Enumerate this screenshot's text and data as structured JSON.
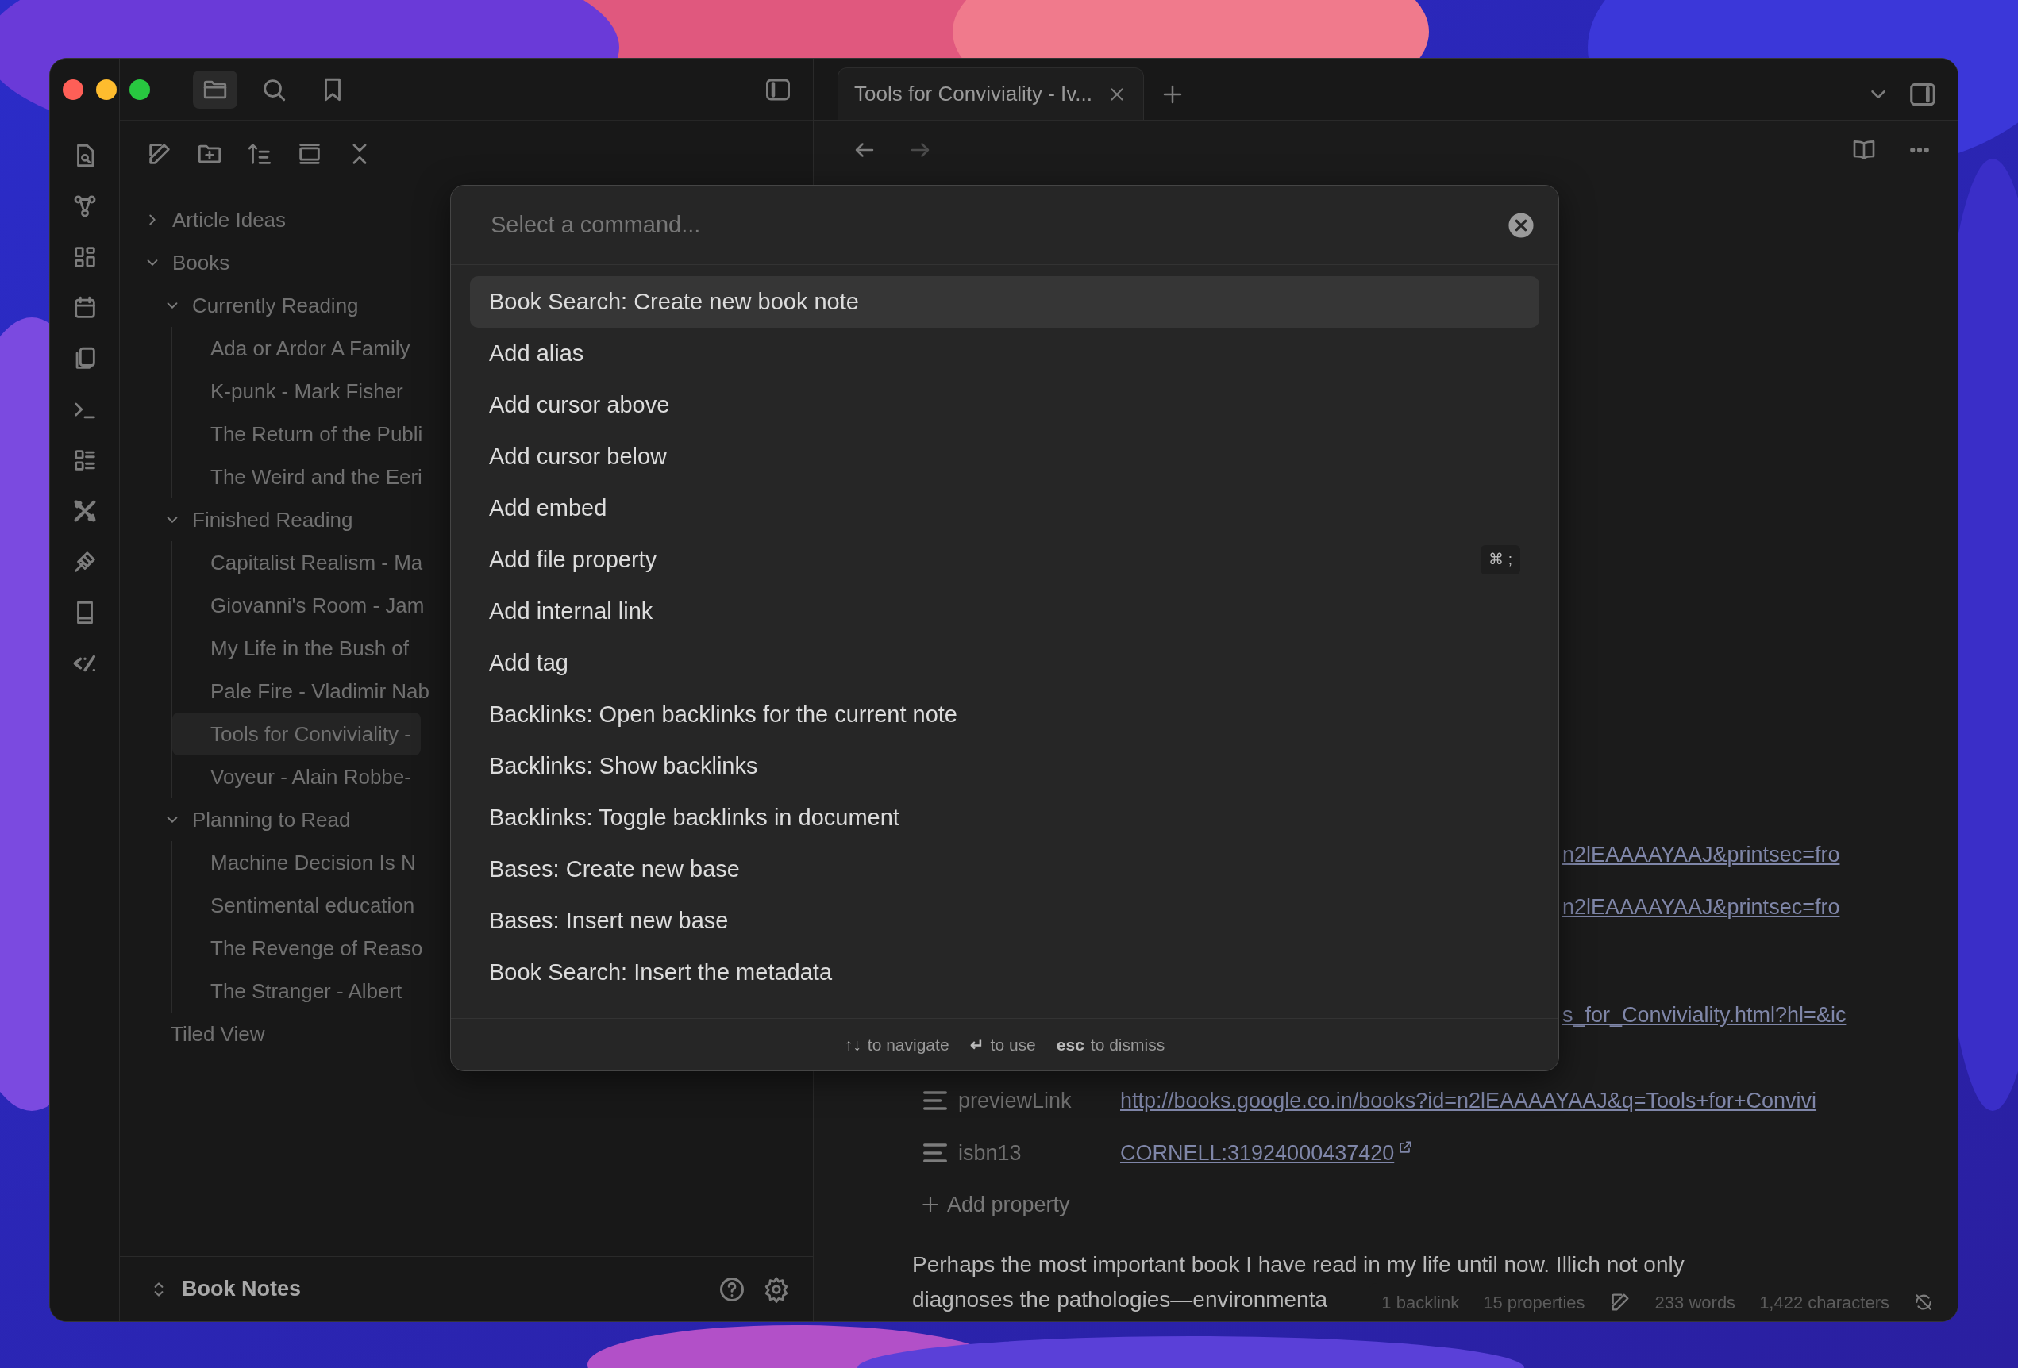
{
  "titlebar": {
    "tools": [
      {
        "kind": "files",
        "selected": true
      },
      {
        "kind": "search",
        "selected": false
      },
      {
        "kind": "bookmarks",
        "selected": false
      }
    ]
  },
  "file_explorer": {
    "tree": [
      {
        "kind": "folder",
        "label": "Article Ideas",
        "expanded": false,
        "selected": false
      },
      {
        "kind": "folder",
        "label": "Books",
        "expanded": true,
        "selected": false,
        "children": [
          {
            "kind": "folder",
            "label": "Currently Reading",
            "expanded": true,
            "selected": false,
            "children": [
              {
                "kind": "file",
                "label": "Ada or Ardor A Family",
                "selected": false
              },
              {
                "kind": "file",
                "label": "K-punk - Mark Fisher",
                "selected": false
              },
              {
                "kind": "file",
                "label": "The Return of the Publi",
                "selected": false
              },
              {
                "kind": "file",
                "label": "The Weird and the Eeri",
                "selected": false
              }
            ]
          },
          {
            "kind": "folder",
            "label": "Finished Reading",
            "expanded": true,
            "selected": false,
            "children": [
              {
                "kind": "file",
                "label": "Capitalist Realism - Ma",
                "selected": false
              },
              {
                "kind": "file",
                "label": "Giovanni's Room - Jam",
                "selected": false
              },
              {
                "kind": "file",
                "label": "My Life in the Bush of",
                "selected": false
              },
              {
                "kind": "file",
                "label": "Pale Fire - Vladimir Nab",
                "selected": false
              },
              {
                "kind": "file",
                "label": "Tools for Conviviality -",
                "selected": true
              },
              {
                "kind": "file",
                "label": "Voyeur - Alain Robbe-",
                "selected": false
              }
            ]
          },
          {
            "kind": "folder",
            "label": "Planning to Read",
            "expanded": true,
            "selected": false,
            "children": [
              {
                "kind": "file",
                "label": "Machine Decision Is N",
                "selected": false
              },
              {
                "kind": "file",
                "label": "Sentimental education",
                "selected": false
              },
              {
                "kind": "file",
                "label": "The Revenge of Reaso",
                "selected": false
              },
              {
                "kind": "file",
                "label": "The Stranger - Albert",
                "selected": false
              }
            ]
          }
        ]
      },
      {
        "kind": "file",
        "label": "Tiled View",
        "selected": false
      }
    ]
  },
  "vault": {
    "name": "Book Notes"
  },
  "tabs": [
    {
      "label": "Tools for Conviviality - Iv...",
      "selected": true
    }
  ],
  "properties": [
    {
      "kind": "clipped",
      "value": "n2lEAAAAYAAJ&printsec=fro"
    },
    {
      "kind": "clipped",
      "value": "n2lEAAAAYAAJ&printsec=fro"
    },
    {
      "kind": "clipped",
      "value": "s_for_Conviviality.html?hl=&ic"
    },
    {
      "kind": "full",
      "key": "previewLink",
      "value": "http://books.google.co.in/books?id=n2lEAAAAYAAJ&q=Tools+for+Convivi"
    },
    {
      "kind": "full",
      "key": "isbn13",
      "value": "CORNELL:31924000437420",
      "external": true
    }
  ],
  "add_property": "Add property",
  "body": {
    "lines": [
      "Perhaps the most important book I have read in my life until now. Illich not only",
      "diagnoses the pathologies—environmenta"
    ]
  },
  "status_bar": [
    {
      "kind": "text",
      "text": "1 backlink"
    },
    {
      "kind": "text",
      "text": "15 properties"
    },
    {
      "kind": "edit-icon"
    },
    {
      "kind": "text",
      "text": "233 words"
    },
    {
      "kind": "text",
      "text": "1,422 characters"
    },
    {
      "kind": "sync-icon"
    }
  ],
  "palette": {
    "placeholder": "Select a command...",
    "commands": [
      {
        "label": "Book Search: Create new book note",
        "selected": true
      },
      {
        "label": "Add alias",
        "selected": false
      },
      {
        "label": "Add cursor above",
        "selected": false
      },
      {
        "label": "Add cursor below",
        "selected": false
      },
      {
        "label": "Add embed",
        "selected": false
      },
      {
        "label": "Add file property",
        "selected": false,
        "hotkey": "⌘ ;"
      },
      {
        "label": "Add internal link",
        "selected": false
      },
      {
        "label": "Add tag",
        "selected": false
      },
      {
        "label": "Backlinks: Open backlinks for the current note",
        "selected": false
      },
      {
        "label": "Backlinks: Show backlinks",
        "selected": false
      },
      {
        "label": "Backlinks: Toggle backlinks in document",
        "selected": false
      },
      {
        "label": "Bases: Create new base",
        "selected": false
      },
      {
        "label": "Bases: Insert new base",
        "selected": false
      },
      {
        "label": "Book Search: Insert the metadata",
        "selected": false
      }
    ],
    "hints": [
      {
        "key": "↑↓",
        "text": "to navigate"
      },
      {
        "key": "↵",
        "text": "to use"
      },
      {
        "key": "esc",
        "text": "to dismiss"
      }
    ]
  }
}
